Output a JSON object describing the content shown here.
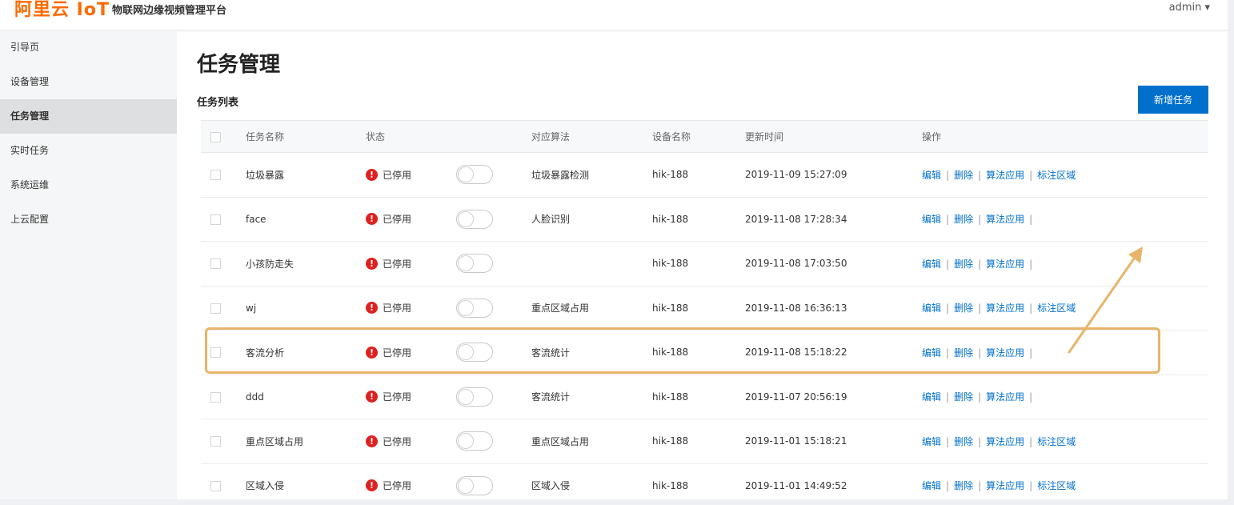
{
  "header": {
    "logo": "阿里云 IoT",
    "platform_title": "物联网边缘视频管理平台",
    "user": "admin ▾"
  },
  "sidebar": {
    "items": [
      {
        "label": "引导页"
      },
      {
        "label": "设备管理"
      },
      {
        "label": "任务管理"
      },
      {
        "label": "实时任务"
      },
      {
        "label": "系统运维"
      },
      {
        "label": "上云配置"
      }
    ]
  },
  "main": {
    "page_title": "任务管理",
    "section_title": "任务列表",
    "add_button": "新增任务"
  },
  "table": {
    "headers": [
      "任务名称",
      "状态",
      "对应算法",
      "设备名称",
      "更新时间",
      "操作"
    ],
    "rows": [
      {
        "name": "垃圾暴露",
        "status": "已停用",
        "algorithm": "垃圾暴露检测",
        "device": "hik-188",
        "updated": "2019-11-09 15:27:09",
        "ops": [
          "编辑",
          "删除",
          "算法应用",
          "标注区域"
        ]
      },
      {
        "name": "face",
        "status": "已停用",
        "algorithm": "人脸识别",
        "device": "hik-188",
        "updated": "2019-11-08 17:28:34",
        "ops": [
          "编辑",
          "删除",
          "算法应用"
        ]
      },
      {
        "name": "小孩防走失",
        "status": "已停用",
        "algorithm": "",
        "device": "hik-188",
        "updated": "2019-11-08 17:03:50",
        "ops": [
          "编辑",
          "删除",
          "算法应用"
        ]
      },
      {
        "name": "wj",
        "status": "已停用",
        "algorithm": "重点区域占用",
        "device": "hik-188",
        "updated": "2019-11-08 16:36:13",
        "ops": [
          "编辑",
          "删除",
          "算法应用",
          "标注区域"
        ]
      },
      {
        "name": "客流分析",
        "status": "已停用",
        "algorithm": "客流统计",
        "device": "hik-188",
        "updated": "2019-11-08 15:18:22",
        "ops": [
          "编辑",
          "删除",
          "算法应用"
        ]
      },
      {
        "name": "ddd",
        "status": "已停用",
        "algorithm": "客流统计",
        "device": "hik-188",
        "updated": "2019-11-07 20:56:19",
        "ops": [
          "编辑",
          "删除",
          "算法应用"
        ]
      },
      {
        "name": "重点区域占用",
        "status": "已停用",
        "algorithm": "重点区域占用",
        "device": "hik-188",
        "updated": "2019-11-01 15:18:21",
        "ops": [
          "编辑",
          "删除",
          "算法应用",
          "标注区域"
        ]
      },
      {
        "name": "区域入侵",
        "status": "已停用",
        "algorithm": "区域入侵",
        "device": "hik-188",
        "updated": "2019-11-01 14:49:52",
        "ops": [
          "编辑",
          "删除",
          "算法应用",
          "标注区域"
        ]
      }
    ]
  },
  "colors": {
    "accent": "#0070cc",
    "status_stopped": "#e02020",
    "highlight": "#e8b46a",
    "logo": "#ff6a00"
  }
}
